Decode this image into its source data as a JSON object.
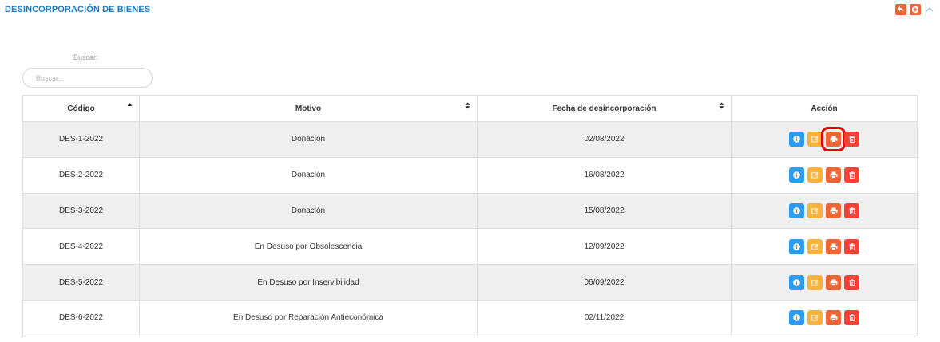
{
  "panel": {
    "title": "DESINCORPORACIÓN DE BIENES",
    "tools": [
      "undo-icon",
      "plus-circle-icon",
      "chevron-up-icon"
    ]
  },
  "search": {
    "label": "Buscar:",
    "placeholder": "Buscar...",
    "value": ""
  },
  "table": {
    "columns": [
      "Código",
      "Motivo",
      "Fecha de desincorporación",
      "Acción"
    ],
    "rows": [
      {
        "codigo": "DES-1-2022",
        "motivo": "Donación",
        "fecha": "02/08/2022"
      },
      {
        "codigo": "DES-2-2022",
        "motivo": "Donación",
        "fecha": "16/08/2022"
      },
      {
        "codigo": "DES-3-2022",
        "motivo": "Donación",
        "fecha": "15/08/2022"
      },
      {
        "codigo": "DES-4-2022",
        "motivo": "En Desuso por Obsolescencia",
        "fecha": "12/09/2022"
      },
      {
        "codigo": "DES-5-2022",
        "motivo": "En Desuso por Inservibilidad",
        "fecha": "06/09/2022"
      },
      {
        "codigo": "DES-6-2022",
        "motivo": "En Desuso por Reparación Antieconómica",
        "fecha": "02/11/2022"
      }
    ],
    "action_icons": [
      "info-icon",
      "edit-icon",
      "print-icon",
      "trash-icon"
    ]
  },
  "colors": {
    "title": "#1e7bbf",
    "info": "#2c9cf0",
    "edit": "#f7b33c",
    "print": "#ef6434",
    "delete": "#f44336",
    "highlight": "#e40000"
  }
}
